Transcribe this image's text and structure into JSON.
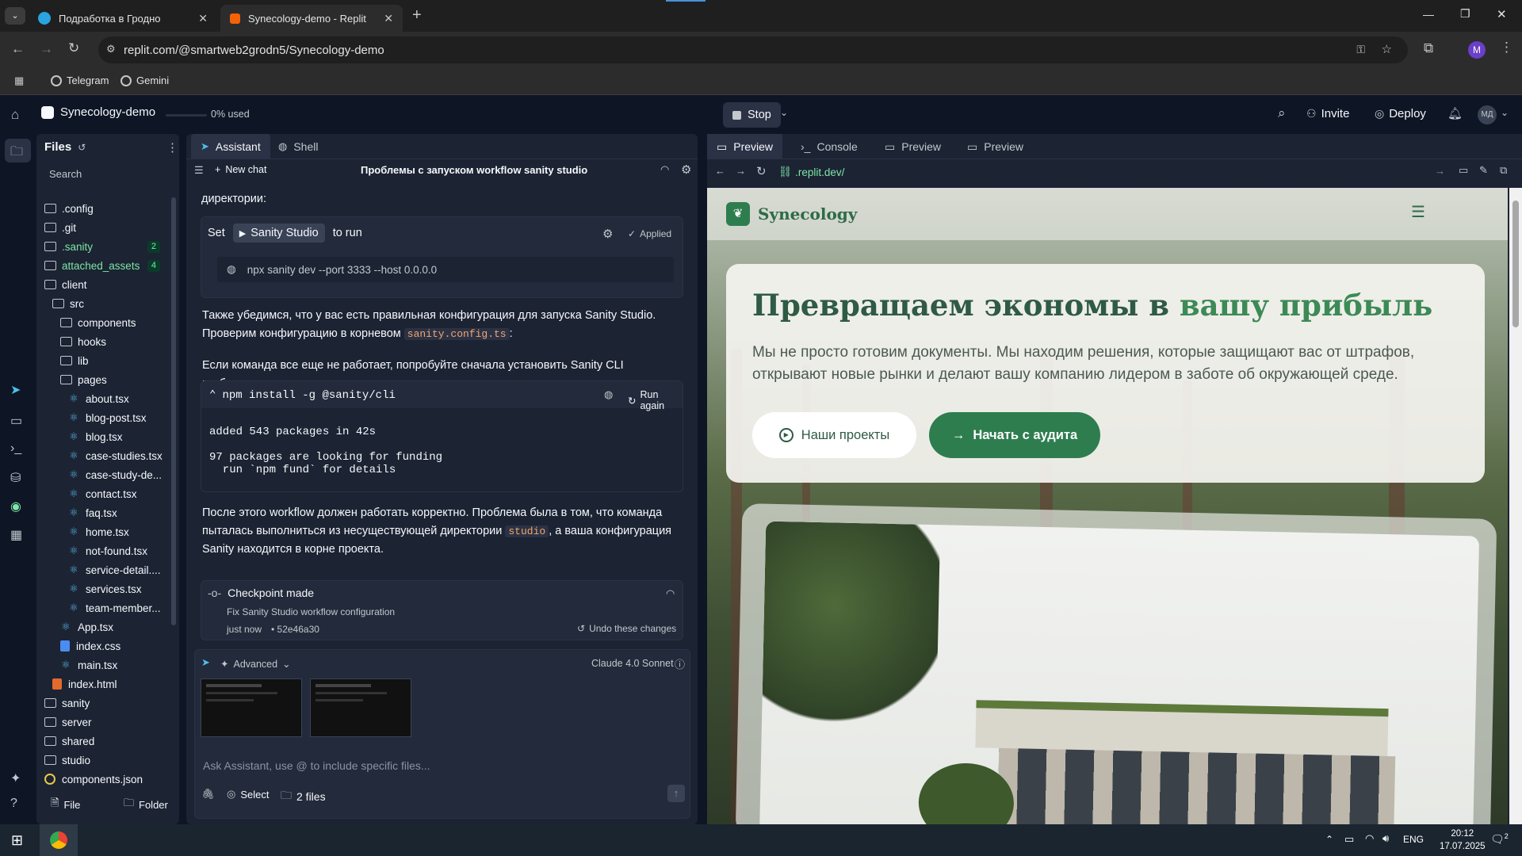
{
  "browser": {
    "tabs": [
      {
        "title": "Подработка в Гродно",
        "active": false
      },
      {
        "title": "Synecology-demo - Replit",
        "active": true
      }
    ],
    "url": "replit.com/@smartweb2grodn5/Synecology-demo",
    "bookmarks": [
      "Telegram",
      "Gemini"
    ],
    "profile_initial": "M"
  },
  "replit": {
    "project_name": "Synecology-demo",
    "usage": "0% used",
    "stop_label": "Stop",
    "invite_label": "Invite",
    "deploy_label": "Deploy",
    "user_initials": "МД"
  },
  "files": {
    "title": "Files",
    "search_placeholder": "Search",
    "tree": [
      {
        "name": ".config",
        "type": "folder",
        "depth": 0
      },
      {
        "name": ".git",
        "type": "folder",
        "depth": 0
      },
      {
        "name": ".sanity",
        "type": "folder",
        "depth": 0,
        "badge": "2",
        "color": "#7ee6a6"
      },
      {
        "name": "attached_assets",
        "type": "folder",
        "depth": 0,
        "badge": "4",
        "color": "#7ee6a6"
      },
      {
        "name": "client",
        "type": "folder",
        "depth": 0
      },
      {
        "name": "src",
        "type": "folder",
        "depth": 1
      },
      {
        "name": "components",
        "type": "folder",
        "depth": 2
      },
      {
        "name": "hooks",
        "type": "folder",
        "depth": 2
      },
      {
        "name": "lib",
        "type": "folder",
        "depth": 2
      },
      {
        "name": "pages",
        "type": "folder",
        "depth": 2
      },
      {
        "name": "about.tsx",
        "type": "tsx",
        "depth": 3
      },
      {
        "name": "blog-post.tsx",
        "type": "tsx",
        "depth": 3
      },
      {
        "name": "blog.tsx",
        "type": "tsx",
        "depth": 3
      },
      {
        "name": "case-studies.tsx",
        "type": "tsx",
        "depth": 3
      },
      {
        "name": "case-study-de...",
        "type": "tsx",
        "depth": 3
      },
      {
        "name": "contact.tsx",
        "type": "tsx",
        "depth": 3
      },
      {
        "name": "faq.tsx",
        "type": "tsx",
        "depth": 3
      },
      {
        "name": "home.tsx",
        "type": "tsx",
        "depth": 3
      },
      {
        "name": "not-found.tsx",
        "type": "tsx",
        "depth": 3
      },
      {
        "name": "service-detail....",
        "type": "tsx",
        "depth": 3
      },
      {
        "name": "services.tsx",
        "type": "tsx",
        "depth": 3
      },
      {
        "name": "team-member...",
        "type": "tsx",
        "depth": 3
      },
      {
        "name": "App.tsx",
        "type": "tsx",
        "depth": 2
      },
      {
        "name": "index.css",
        "type": "css",
        "depth": 2
      },
      {
        "name": "main.tsx",
        "type": "tsx",
        "depth": 2
      },
      {
        "name": "index.html",
        "type": "html",
        "depth": 1
      },
      {
        "name": "sanity",
        "type": "folder",
        "depth": 0
      },
      {
        "name": "server",
        "type": "folder",
        "depth": 0
      },
      {
        "name": "shared",
        "type": "folder",
        "depth": 0
      },
      {
        "name": "studio",
        "type": "folder",
        "depth": 0
      },
      {
        "name": "components.json",
        "type": "json",
        "depth": 0
      }
    ],
    "new_file_label": "File",
    "new_folder_label": "Folder"
  },
  "assistant": {
    "tabs": [
      "Assistant",
      "Shell"
    ],
    "new_chat_label": "New chat",
    "chat_title": "Проблемы с запуском workflow sanity studio",
    "prev_text_tail": "директории:",
    "workflow_card": {
      "set_label": "Set",
      "workflow_name": "Sanity Studio",
      "to_run_label": "to run",
      "applied_label": "Applied",
      "command": "npx sanity dev --port 3333 --host 0.0.0.0"
    },
    "para1": "Также убедимся, что у вас есть правильная конфигурация для запуска Sanity Studio. Проверим конфигурацию в корневом",
    "para1_code": "sanity.config.ts",
    "para2": "Если команда все еще не работает, попробуйте сначала установить Sanity CLI глобально:",
    "shell_card": {
      "command": "npm install -g @sanity/cli",
      "run_again_label": "Run again",
      "output_line1": "added 543 packages in 42s",
      "output_line2": "97 packages are looking for funding",
      "output_line3": "  run `npm fund` for details"
    },
    "para3_a": "После этого workflow должен работать корректно. Проблема была в том, что команда пыталась выполниться из несуществующей директории",
    "para3_code": "studio",
    "para3_b": ", а ваша конфигурация Sanity находится в корне проекта.",
    "checkpoint": {
      "title": "Checkpoint made",
      "description": "Fix Sanity Studio workflow configuration",
      "time": "just now",
      "hash": "• 52e46a30",
      "undo_label": "Undo these changes"
    },
    "input": {
      "advanced_label": "Advanced",
      "model_label": "Claude 4.0 Sonnet",
      "placeholder": "Ask Assistant, use @ to include specific files...",
      "select_label": "Select",
      "files_label": "2 files"
    }
  },
  "preview": {
    "tabs": [
      "Preview",
      "Console",
      "Preview",
      "Preview"
    ],
    "url": ".replit.dev/",
    "site": {
      "brand": "Synecology",
      "hero_title_a": "Превращаем экономы в",
      "hero_title_b": "вашу прибыль",
      "hero_subtitle": "Мы не просто готовим документы. Мы находим решения, которые защищают вас от штрафов, открывают новые рынки и делают вашу компанию лидером в заботе об окружающей среде.",
      "btn_projects": "Наши проекты",
      "btn_audit": "Начать с аудита",
      "accent": "#2e7d4f"
    }
  },
  "taskbar": {
    "lang": "ENG",
    "time": "20:12",
    "date": "17.07.2025",
    "notif_count": "2"
  }
}
